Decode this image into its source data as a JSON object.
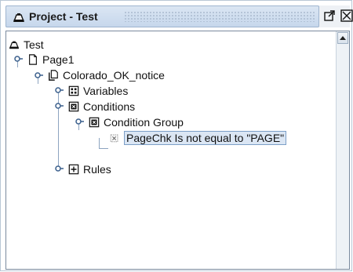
{
  "window": {
    "title": "Project - Test",
    "icons": {
      "title": "project-icon",
      "float": "float-icon",
      "close": "close-icon"
    }
  },
  "tree": {
    "nodes": [
      {
        "label": "Test",
        "icon": "project-icon"
      },
      {
        "label": "Page1",
        "icon": "page-icon"
      },
      {
        "label": "Colorado_OK_notice",
        "icon": "document-icon"
      },
      {
        "label": "Variables",
        "icon": "variables-icon"
      },
      {
        "label": "Conditions",
        "icon": "conditions-icon"
      },
      {
        "label": "Condition Group",
        "icon": "condition-group-icon"
      },
      {
        "label": "PageChk Is not equal to \"PAGE\"",
        "icon": "condition-icon",
        "selected": true
      },
      {
        "label": "Rules",
        "icon": "rules-icon"
      }
    ]
  },
  "colors": {
    "selection_bg": "#dbe6f4",
    "selection_border": "#7d9fc7",
    "tree_lines": "#8da4c0"
  }
}
